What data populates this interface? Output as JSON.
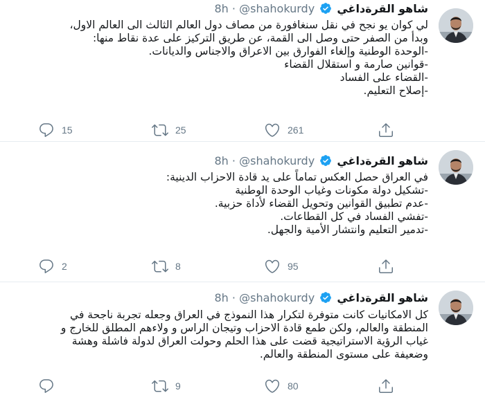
{
  "tweets": [
    {
      "name": "شاهو القرةداغي",
      "handle": "@shahokurdy",
      "sep": "·",
      "time": "8h",
      "lines": [
        "لي كوان يو نجح في نقل سنغافورة من مصاف دول العالم الثالث الى العالم الاول،",
        "وبدأ من الصفر حتى وصل الى القمة، عن طريق التركيز على عدة نقاط منها:",
        "-الوحدة الوطنية وإلغاء الفوارق بين الاعراق والاجناس والديانات.",
        "-قوانين صارمة و استقلال القضاء",
        "-القضاء على الفساد",
        "-إصلاح التعليم."
      ],
      "replies": "15",
      "retweets": "25",
      "likes": "261"
    },
    {
      "name": "شاهو القرةداغي",
      "handle": "@shahokurdy",
      "sep": "·",
      "time": "8h",
      "lines": [
        "في العراق حصل العكس تماماً على يد قادة الاحزاب الدينية:",
        "-تشكيل دولة مكونات وغياب الوحدة الوطنية",
        "-عدم تطبيق القوانين وتحويل القضاء لأداة حزبية.",
        "-تفشي الفساد في كل القطاعات.",
        "-تدمير التعليم وانتشار الأمية والجهل."
      ],
      "replies": "2",
      "retweets": "8",
      "likes": "95"
    },
    {
      "name": "شاهو القرةداغي",
      "handle": "@shahokurdy",
      "sep": "·",
      "time": "8h",
      "lines": [
        "كل الامكانيات كانت متوفرة لتكرار هذا النموذج في العراق وجعله تجربة ناجحة في",
        "المنطقة والعالم، ولكن طمع قادة الاحزاب وتيجان الراس و ولاءهم المطلق للخارج و",
        "غياب الرؤية الاستراتيجية قضت على هذا الحلم وحولت العراق لدولة فاشلة وهشة",
        "وضعيفة على مستوى المنطقة والعالم."
      ],
      "replies": "",
      "retweets": "9",
      "likes": "80"
    }
  ],
  "colors": {
    "text": "#14171a",
    "secondary": "#657786",
    "verified": "#1da1f2",
    "border": "#e6ecf0"
  },
  "icons": [
    "avatar",
    "verified-badge-icon",
    "reply-icon",
    "retweet-icon",
    "like-icon",
    "share-icon"
  ]
}
